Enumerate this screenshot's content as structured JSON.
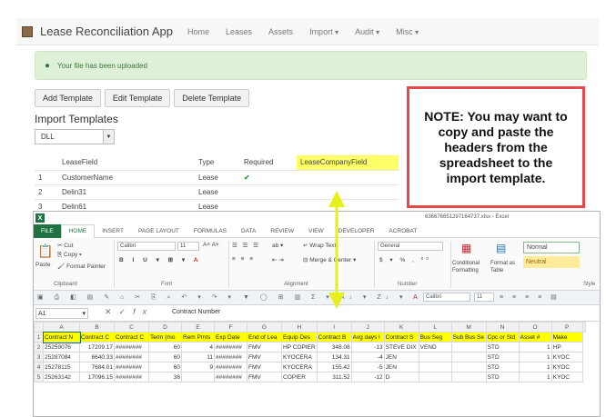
{
  "app": {
    "title": "Lease Reconciliation App",
    "nav": [
      {
        "label": "Home",
        "caret": false
      },
      {
        "label": "Leases",
        "caret": false
      },
      {
        "label": "Assets",
        "caret": false
      },
      {
        "label": "Import",
        "caret": true
      },
      {
        "label": "Audit",
        "caret": true
      },
      {
        "label": "Misc",
        "caret": true
      }
    ],
    "alert": "Your file has been uploaded",
    "buttons": {
      "add": "Add Template",
      "edit": "Edit Template",
      "delete": "Delete Template"
    },
    "section_title": "Import Templates",
    "select_value": "DLL",
    "table": {
      "headers": [
        "LeaseField",
        "Type",
        "Required",
        "LeaseCompanyField"
      ],
      "rows": [
        {
          "num": "1",
          "field": "CustomerName",
          "type": "Lease",
          "required": "✔"
        },
        {
          "num": "2",
          "field": "Delin31",
          "type": "Lease",
          "required": ""
        },
        {
          "num": "3",
          "field": "Delin61",
          "type": "Lease",
          "required": ""
        }
      ]
    }
  },
  "note": "NOTE: You may want to copy and paste the headers from the spreadsheet to the import template.",
  "excel": {
    "window_title": "636676651297164737.xlsx - Excel",
    "tabs": [
      "FILE",
      "HOME",
      "INSERT",
      "PAGE LAYOUT",
      "FORMULAS",
      "DATA",
      "REVIEW",
      "VIEW",
      "DEVELOPER",
      "ACROBAT"
    ],
    "active_tab": "HOME",
    "ribbon": {
      "cut": "Cut",
      "copy": "Copy",
      "paste": "Paste",
      "format_painter": "Format Painter",
      "clipboard": "Clipboard",
      "font_name": "Calibri",
      "font_size": "11",
      "font": "Font",
      "wrap_text": "Wrap Text",
      "merge_center": "Merge & Center",
      "alignment": "Alignment",
      "number_format": "General",
      "number": "Number",
      "conditional_formatting": "Conditional Formatting",
      "format_as_table": "Format as Table",
      "style_normal": "Normal",
      "style_neutral": "Neutral",
      "styles": "Style",
      "qat_font": "Calibri",
      "qat_size": "11"
    },
    "name_box": "A1",
    "formula": "Contract Number",
    "columns": [
      "A",
      "B",
      "C",
      "D",
      "E",
      "F",
      "G",
      "H",
      "I",
      "J",
      "K",
      "L",
      "M",
      "N",
      "O",
      "P"
    ],
    "rows": [
      [
        "1",
        "Contract N",
        "Contract C",
        "Contract C",
        "Term (mo",
        "Rem Pmts",
        "Exp Date",
        "End of Lea",
        "Equip Des",
        "Contract B",
        "Avg days l",
        "Contract S",
        "Bus Seg",
        "Sub Bus Se",
        "Cpc or Std",
        "Asset #",
        "Make"
      ],
      [
        "2",
        "25259076",
        "17209.17",
        "########",
        "60",
        "4",
        "########",
        "FMV",
        "HP COPIER",
        "348.08",
        "-13",
        "STEVE DIX",
        "VEND",
        "",
        "STD",
        "1",
        "HP"
      ],
      [
        "3",
        "25287084",
        "6640.33",
        "########",
        "60",
        "11",
        "########",
        "FMV",
        "KYOCERA",
        "134.31",
        "-4",
        "JEN",
        "",
        "",
        "STD",
        "1",
        "KYOC"
      ],
      [
        "4",
        "25278115",
        "7684.01",
        "########",
        "60",
        "9",
        "########",
        "FMV",
        "KYOCERA",
        "155.42",
        "-5",
        "JEN",
        "",
        "",
        "STD",
        "1",
        "KYOC"
      ],
      [
        "5",
        "25263142",
        "17096.15",
        "########",
        "36",
        "",
        "########",
        "FMV",
        "COPIER",
        "311.52",
        "-12",
        "D",
        "",
        "",
        "STD",
        "1",
        "KYOC"
      ]
    ]
  },
  "colors": {
    "note_border": "#e8474a",
    "highlight": "#ffff66",
    "excel_green": "#217346",
    "arrow": "#e6ef1a"
  }
}
